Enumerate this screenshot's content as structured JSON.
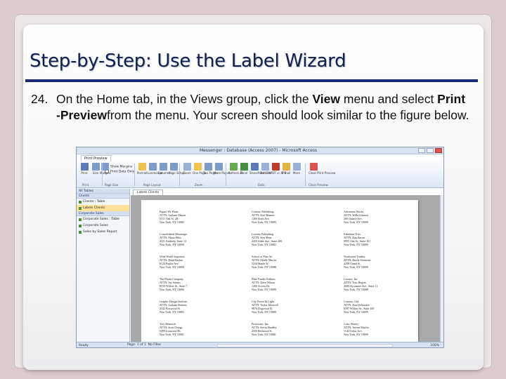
{
  "slide": {
    "title": "Step-by-Step: Use the Label Wizard",
    "step_number": "24.",
    "step_parts": [
      "On the Home tab, in the Views group, click the ",
      "View",
      " menu and select ",
      "Print -Preview",
      "from the menu. Your screen should look similar to the figure below."
    ]
  },
  "screenshot": {
    "window_title": "Messenger : Database (Access 2007) - Microsoft Access",
    "ribbon_tab": "Print Preview",
    "checkboxes": [
      "Show Margins",
      "Print Data Only"
    ],
    "buttons": [
      {
        "label": "Print",
        "icon": "printer-icon",
        "color": "#5a7bb5"
      },
      {
        "label": "Size",
        "icon": "page-size-icon",
        "color": "#7f9cc9"
      },
      {
        "label": "Margins",
        "icon": "margins-icon",
        "color": "#7f9cc9"
      },
      {
        "label": "Portrait",
        "icon": "portrait-icon",
        "color": "#f0c24b"
      },
      {
        "label": "Landscape",
        "icon": "landscape-icon",
        "color": "#7f9cc9"
      },
      {
        "label": "Columns",
        "icon": "columns-icon",
        "color": "#7f9cc9"
      },
      {
        "label": "Page Setup",
        "icon": "page-setup-icon",
        "color": "#7f9cc9"
      },
      {
        "label": "Zoom",
        "icon": "zoom-icon",
        "color": "#9ab0d6"
      },
      {
        "label": "One Page",
        "icon": "one-page-icon",
        "color": "#f0c24b"
      },
      {
        "label": "Two Pages",
        "icon": "two-pages-icon",
        "color": "#7f9cc9"
      },
      {
        "label": "More Pages",
        "icon": "more-pages-icon",
        "color": "#7f9cc9"
      },
      {
        "label": "Refresh All",
        "icon": "refresh-icon",
        "color": "#6aa84f"
      },
      {
        "label": "Excel",
        "icon": "excel-icon",
        "color": "#3f8f3f"
      },
      {
        "label": "SharePoint List",
        "icon": "sharepoint-icon",
        "color": "#5a7bb5"
      },
      {
        "label": "Text File",
        "icon": "text-file-icon",
        "color": "#9ab0d6"
      },
      {
        "label": "PDF or XPS",
        "icon": "pdf-icon",
        "color": "#c0392b"
      },
      {
        "label": "E-mail",
        "icon": "email-icon",
        "color": "#e3b341"
      },
      {
        "label": "More",
        "icon": "more-icon",
        "color": "#9ab0d6"
      },
      {
        "label": "Close Print Preview",
        "icon": "close-preview-icon",
        "color": "#d9534f"
      }
    ],
    "groups": [
      "Print",
      "Page Size",
      "Page Layout",
      "Zoom",
      "Data",
      "Close Preview"
    ],
    "nav": {
      "header": "All Tables",
      "sections": [
        {
          "name": "Clients",
          "items": [
            "Clients : Table",
            "Labels Clients"
          ]
        },
        {
          "name": "Corporate Sales",
          "items": [
            "Corporate Sales : Table",
            "Corporate Sales",
            "Sales by Sales Report"
          ]
        }
      ]
    },
    "doc_tab": "Labels Clients",
    "labels": [
      [
        "Figure We Plans",
        "ATTN: Graham Mason",
        "5511 Oak St. 2B",
        "New York, NY 10085"
      ],
      [
        "Contoso Publishing",
        "ATTN: Karl Reuters",
        "1260 Sixth Ave.",
        "New York, NY 10085"
      ],
      [
        "Adventure Works",
        "ATTN: Willa Johnson",
        "200 Quince Ave.",
        "New York, NY 10099"
      ],
      [
        "Consolidated Messenger",
        "ATTN: Marie Hess",
        "4521 Amberly, Suite 12",
        "New York, NY 10090"
      ],
      [
        "Lucerne Publishing",
        "ATTN: Ken Myer",
        "2450 Alder Ave., Suite 200",
        "New York, NY 10082"
      ],
      [
        "Fabrikam Toys",
        "ATTN: Dan Bacon",
        "9855 Oak St., Suite 101",
        "New York, NY 10099"
      ],
      [
        "Wide World Importers",
        "ATTN: Benji Baskin",
        "8124 Poplar Ave.",
        "New York, NY 10084"
      ],
      [
        "School of Fine Art",
        "ATTN: Mindy Martin",
        "5234 Maple St.",
        "New York, NY 10088"
      ],
      [
        "Northwind Traders",
        "ATTN: Sheila Simmons",
        "4298 Grand St.",
        "New York, NY 10099"
      ],
      [
        "The Phone Company",
        "ATTN: Jay Adams",
        "9512 Willow St., Suite 7",
        "New York, NY 10080"
      ],
      [
        "Blue Yonder Airlines",
        "ATTN: Dave Wilson",
        "1200 Access Dr.",
        "New York, NY 10089"
      ],
      [
        "Litware, Inc.",
        "ATTN: Tom Rogers",
        "3600 Sycamore Ave., Suite 11",
        "New York, NY 10088"
      ],
      [
        "Graphic Design Institute",
        "ATTN: Graham Roberts",
        "2542 Boxwood St.",
        "New York, NY 10083"
      ],
      [
        "City Power & Light",
        "ATTN: Taylor Maxwell",
        "9876 Dogwood St.",
        "New York, NY 10089"
      ],
      [
        "Contoso, Ltd.",
        "ATTN: Ken Dellaware",
        "6597 Willow St., Suite 100",
        "New York, NY 10099"
      ],
      [
        "Trey Research",
        "ATTN: Scott Ortega",
        "5499 Ironwood Dr.",
        "New York, NY 10081"
      ],
      [
        "Proseware, Inc.",
        "ATTN: Kevin Bradley",
        "2500 Redwood St.",
        "New York, NY 10081"
      ],
      [
        "Coho Winery",
        "ATTN: Steven Maylor",
        "1144 Cedar Ave.",
        "New York, NY 10099"
      ]
    ],
    "status_text": "Ready",
    "page_nav": "Page: 1 of 1",
    "filter_text": "No Filter",
    "zoom_level": "100%"
  }
}
